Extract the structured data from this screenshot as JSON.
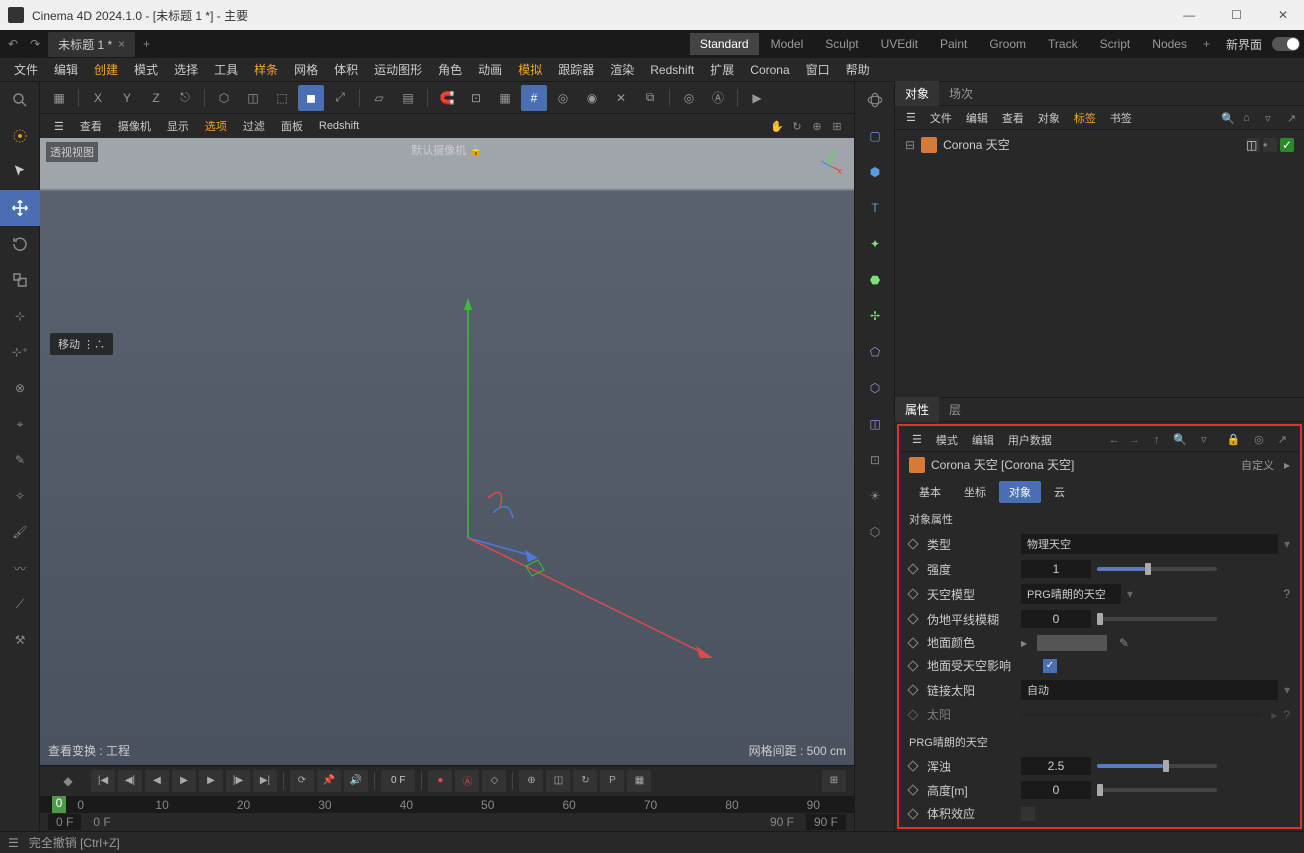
{
  "titlebar": {
    "text": "Cinema 4D 2024.1.0 - [未标题 1 *] - 主要"
  },
  "tab": {
    "name": "未标题 1 *"
  },
  "layouts": [
    "Standard",
    "Model",
    "Sculpt",
    "UVEdit",
    "Paint",
    "Groom",
    "Track",
    "Script",
    "Nodes"
  ],
  "newui": "新界面",
  "menubar": [
    "文件",
    "编辑",
    "创建",
    "模式",
    "选择",
    "工具",
    "样条",
    "网格",
    "体积",
    "运动图形",
    "角色",
    "动画",
    "模拟",
    "跟踪器",
    "渲染",
    "Redshift",
    "扩展",
    "Corona",
    "窗口",
    "帮助"
  ],
  "menubar_orange_idx": [
    2,
    6,
    12
  ],
  "axis": {
    "x": "X",
    "y": "Y",
    "z": "Z"
  },
  "vp_menu": [
    "查看",
    "摄像机",
    "显示",
    "选项",
    "过滤",
    "面板",
    "Redshift"
  ],
  "vp_menu_orange_idx": [
    3
  ],
  "viewport": {
    "label": "透视视图",
    "camera": "默认摄像机 🔒",
    "tooltip": "移动 ⋮∴",
    "bl": "查看变换 : 工程",
    "br": "网格间距 : 500 cm"
  },
  "timeline": {
    "frame": "0 F",
    "ticks": [
      "0",
      "10",
      "20",
      "30",
      "40",
      "50",
      "60",
      "70",
      "80",
      "90"
    ],
    "start": "0 F",
    "cursor": "0 F",
    "end": "90 F",
    "end2": "90 F"
  },
  "panels": {
    "top_tabs": [
      "对象",
      "场次"
    ],
    "obj_menu": [
      "文件",
      "编辑",
      "查看",
      "对象",
      "标签",
      "书签"
    ],
    "obj_menu_orange_idx": [
      4
    ],
    "obj_name": "Corona 天空",
    "attr_tabs_top": [
      "属性",
      "层"
    ],
    "attr_menu": [
      "模式",
      "编辑",
      "用户数据"
    ],
    "attr_title": "Corona 天空 [Corona 天空]",
    "custom": "自定义",
    "attr_sub_tabs": [
      "基本",
      "坐标",
      "对象",
      "云"
    ],
    "section": "对象属性",
    "rows": {
      "type": {
        "label": "类型",
        "value": "物理天空"
      },
      "intensity": {
        "label": "强度",
        "value": "1"
      },
      "sky_model": {
        "label": "天空模型",
        "value": "PRG晴朗的天空"
      },
      "horizon_blur": {
        "label": "伪地平线模糊",
        "value": "0"
      },
      "ground_color": {
        "label": "地面颜色"
      },
      "ground_sky": {
        "label": "地面受天空影响"
      },
      "link_sun": {
        "label": "链接太阳",
        "value": "自动"
      },
      "sun": {
        "label": "太阳"
      },
      "prg_section": "PRG晴朗的天空",
      "turbidity": {
        "label": "浑浊",
        "value": "2.5"
      },
      "altitude": {
        "label": "高度[m]",
        "value": "0"
      },
      "volume": {
        "label": "体积效应"
      }
    }
  },
  "statusbar": "完全撤销 [Ctrl+Z]"
}
